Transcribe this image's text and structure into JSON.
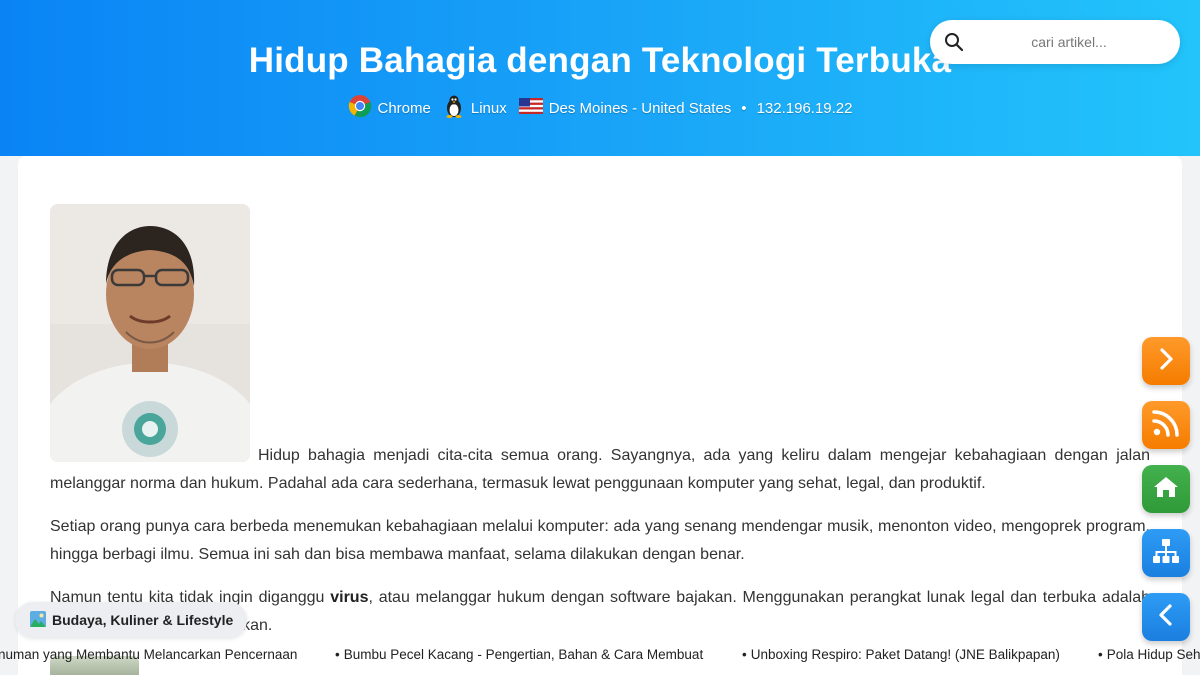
{
  "header": {
    "title": "Hidup Bahagia dengan Teknologi Terbuka",
    "browser": "Chrome",
    "os": "Linux",
    "location": "Des Moines - United States",
    "separator": "•",
    "ip": "132.196.19.22"
  },
  "search": {
    "placeholder": "cari artikel..."
  },
  "article": {
    "p1": "Hidup bahagia menjadi cita-cita semua orang. Sayangnya, ada yang keliru dalam mengejar kebahagiaan dengan jalan melanggar norma dan hukum. Padahal ada cara sederhana, termasuk lewat penggunaan komputer yang sehat, legal, dan produktif.",
    "p2": "Setiap orang punya cara berbeda menemukan kebahagiaan melalui komputer: ada yang senang mendengar musik, menonton video, mengoprek program, hingga berbagi ilmu. Semua ini sah dan bisa membawa manfaat, selama dilakukan dengan benar.",
    "p3_before": "Namun tentu kita tidak ingin diganggu ",
    "p3_bold": "virus",
    "p3_after": ", atau melanggar hukum dengan software bajakan. Menggunakan perangkat lunak legal dan terbuka adalah langkah yang membahagiakan."
  },
  "category": {
    "icon": "landscape-icon",
    "label": "Budaya, Kuliner & Lifestyle"
  },
  "ticker": {
    "bullet": "•",
    "items": [
      "numan yang Membantu Melancarkan Pencernaan",
      "Bumbu Pecel Kacang - Pengertian, Bahan & Cara Membuat",
      "Unboxing Respiro: Paket Datang! (JNE Balikpapan)",
      "Pola Hidup Seh"
    ]
  },
  "side_buttons": [
    {
      "name": "next",
      "icon": "chevron-right-icon",
      "color": "#f57c00"
    },
    {
      "name": "rss",
      "icon": "rss-icon",
      "color": "#f57c00"
    },
    {
      "name": "home",
      "icon": "home-icon",
      "color": "#2e9a38"
    },
    {
      "name": "sitemap",
      "icon": "sitemap-icon",
      "color": "#1a7fe0"
    },
    {
      "name": "prev",
      "icon": "chevron-left-icon",
      "color": "#1a7fe0"
    }
  ],
  "colors": {
    "header_start": "#0a84f5",
    "header_end": "#22c4fb"
  }
}
